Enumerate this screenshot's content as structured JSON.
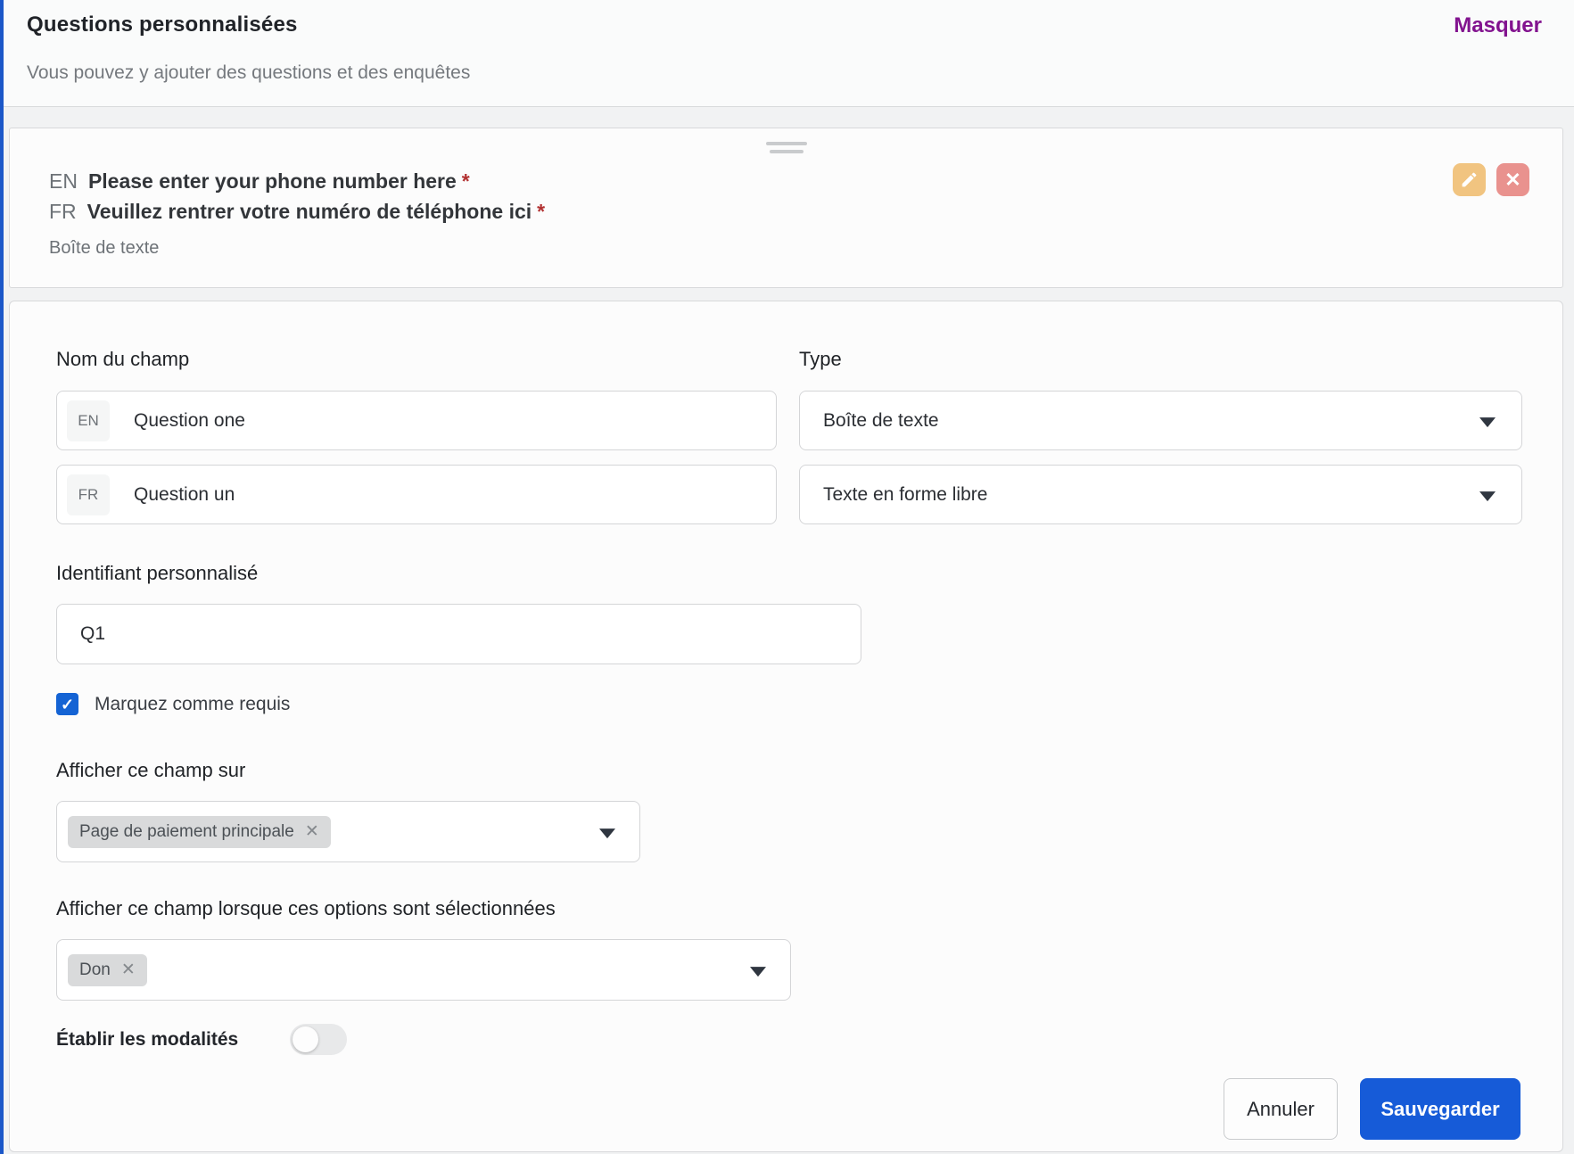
{
  "header": {
    "title": "Questions personnalisées",
    "subtitle": "Vous pouvez y ajouter des questions et des enquêtes",
    "hide_link": "Masquer"
  },
  "question_card": {
    "en_prefix": "EN",
    "en_text": "Please enter your phone number here",
    "fr_prefix": "FR",
    "fr_text": "Veuillez rentrer votre numéro de téléphone ici",
    "required_marker": "*",
    "type_name": "Boîte de texte"
  },
  "form": {
    "field_name_label": "Nom du champ",
    "type_label": "Type",
    "name_en": {
      "prefix": "EN",
      "value": "Question one"
    },
    "name_fr": {
      "prefix": "FR",
      "value": "Question un"
    },
    "type_select_primary": "Boîte de texte",
    "type_select_secondary": "Texte en forme libre",
    "custom_id_label": "Identifiant personnalisé",
    "custom_id_value": "Q1",
    "required_checkbox_label": "Marquez comme requis",
    "required_checked": true,
    "show_on_label": "Afficher ce champ sur",
    "show_on_tags": [
      "Page de paiement principale"
    ],
    "show_when_label": "Afficher ce champ lorsque ces options sont sélectionnées",
    "show_when_tags": [
      "Don"
    ],
    "modalities_label": "Établir les modalités",
    "modalities_enabled": false,
    "cancel_button": "Annuler",
    "save_button": "Sauvegarder"
  },
  "icons": {
    "check": "✓",
    "remove": "✕",
    "close": "✕"
  },
  "colors": {
    "accent_blue": "#165bd8",
    "accent_purple": "#82138f",
    "required_red": "#b23131",
    "edit_btn_bg": "#f1c480",
    "delete_btn_bg": "#e9928e",
    "tag_bg": "#d9dadb"
  }
}
